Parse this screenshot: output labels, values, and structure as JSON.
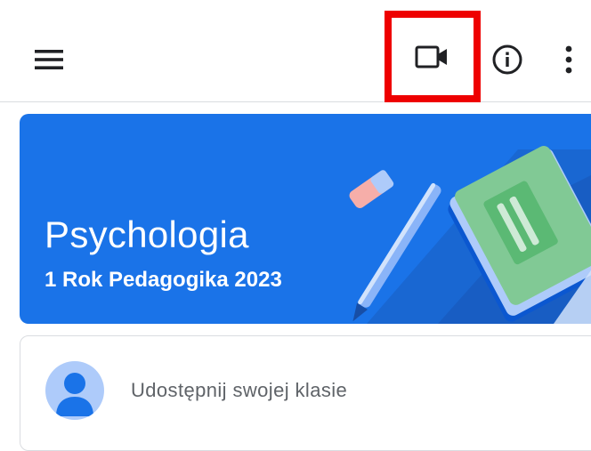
{
  "toolbar": {
    "menu_icon": "hamburger-menu-icon",
    "video_icon": "videocam-outline-icon",
    "info_icon": "info-outline-icon",
    "more_icon": "more-vert-icon",
    "highlight_color": "#ee0000"
  },
  "banner": {
    "title": "Psychologia",
    "subtitle": "1 Rok Pedagogika 2023",
    "background_color": "#1a73e8"
  },
  "share": {
    "prompt": "Udostępnij swojej klasie",
    "avatar_icon": "default-avatar-icon"
  }
}
